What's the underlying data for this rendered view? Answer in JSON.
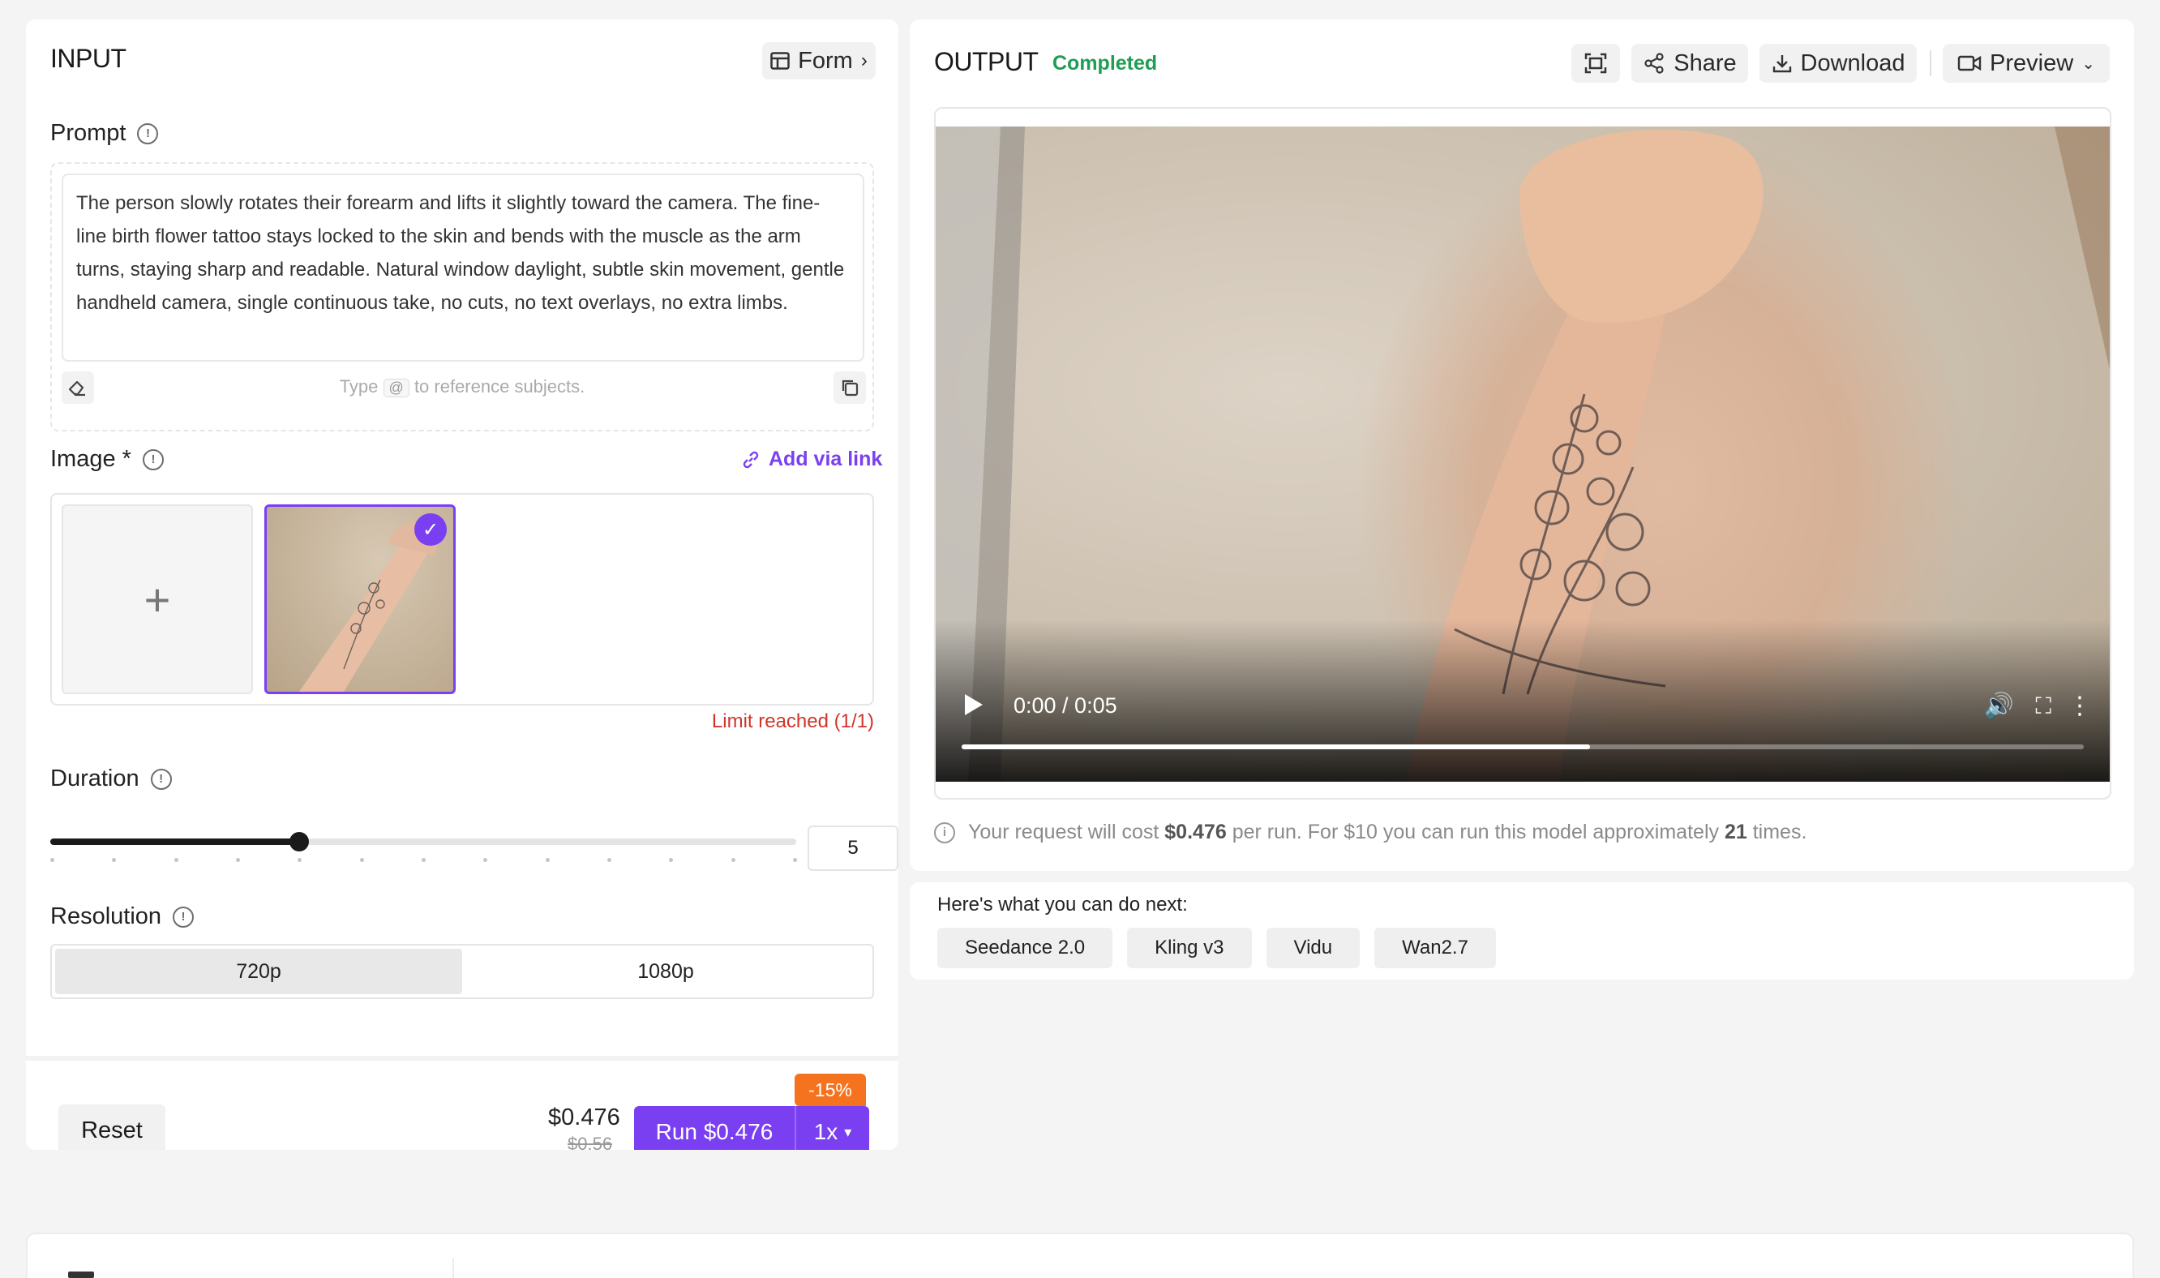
{
  "input": {
    "title": "INPUT",
    "form_label": "Form",
    "prompt": {
      "label": "Prompt",
      "text": "The person slowly rotates their forearm and lifts it slightly toward the camera. The fine-line birth flower tattoo stays locked to the skin and bends with the muscle as the arm turns, staying sharp and readable. Natural window daylight, subtle skin movement, gentle handheld camera, single continuous take, no cuts, no text overlays, no extra limbs.",
      "hint_before": "Type",
      "hint_key": "@",
      "hint_after": "to reference subjects."
    },
    "image": {
      "label": "Image *",
      "add_link": "Add via link",
      "upload_symbol": "+",
      "limit_text": "Limit reached (1/1)"
    },
    "duration": {
      "label": "Duration",
      "value": "5",
      "min": 1,
      "max": 13,
      "tick_count": 13
    },
    "resolution": {
      "label": "Resolution",
      "options": [
        "720p",
        "1080p"
      ],
      "selected": "720p"
    },
    "footer": {
      "reset_label": "Reset",
      "price": "$0.476",
      "old_price": "$0.56",
      "run_label": "Run $0.476",
      "multiplier": "1x",
      "discount": "-15%"
    }
  },
  "output": {
    "title": "OUTPUT",
    "status": "Completed",
    "status_color": "#1f9d55",
    "share_label": "Share",
    "download_label": "Download",
    "preview_label": "Preview",
    "video": {
      "time": "0:00 / 0:05",
      "progress_fraction": 0.56
    },
    "cost": {
      "prefix": "Your request will cost",
      "price": "$0.476",
      "middle": "per run. For $10 you can run this model approximately",
      "count": "21",
      "suffix": "times."
    }
  },
  "next": {
    "title": "Here's what you can do next:",
    "chips": [
      "Seedance 2.0",
      "Kling v3",
      "Vidu",
      "Wan2.7"
    ]
  },
  "colors": {
    "accent": "#7b3ff2",
    "limit_red": "#d0342c",
    "discount_orange": "#f5731f"
  }
}
